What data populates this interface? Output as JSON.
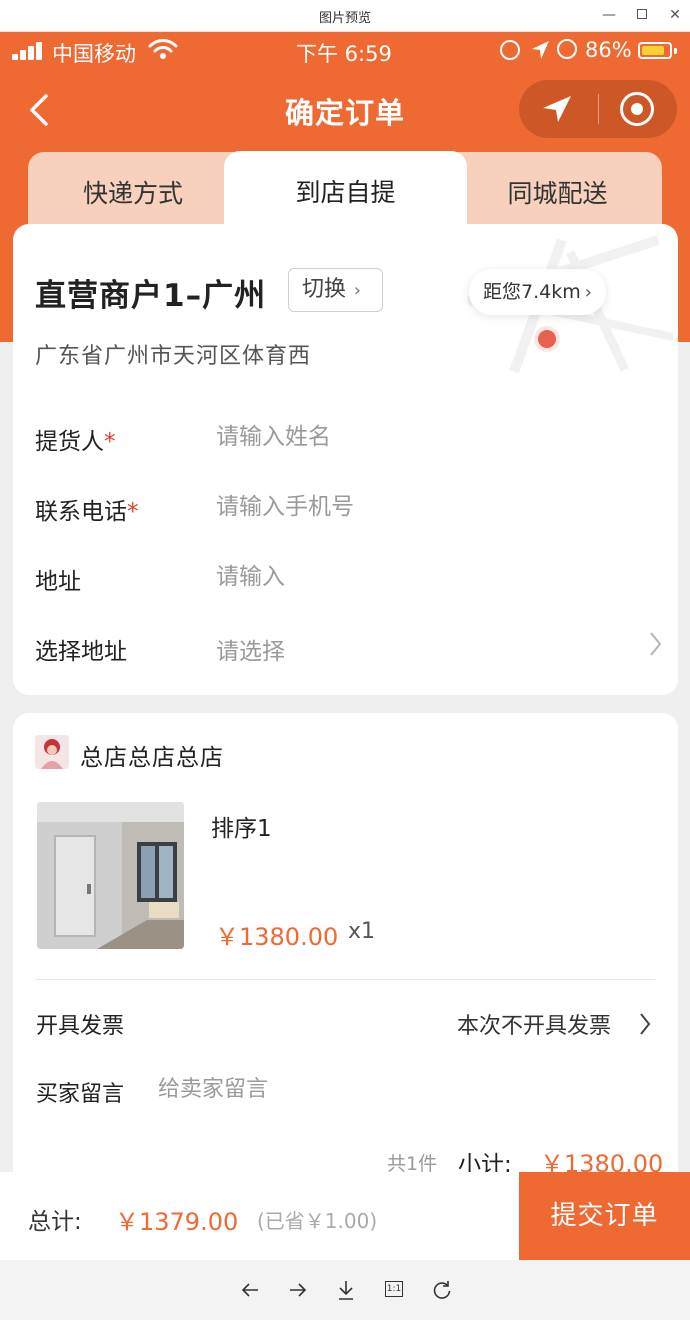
{
  "window": {
    "title": "图片预览",
    "minimize_label": "—",
    "close_label": "✕"
  },
  "status_bar": {
    "carrier": "中国移动",
    "time": "下午 6:59",
    "battery_percent": "86%",
    "battery_level": 0.86
  },
  "nav": {
    "title": "确定订单"
  },
  "tabs": [
    {
      "label": "快递方式",
      "active": false
    },
    {
      "label": "到店自提",
      "active": true
    },
    {
      "label": "同城配送",
      "active": false
    }
  ],
  "store": {
    "name": "直营商户1–广州",
    "switch_label": "切换",
    "address": "广东省广州市天河区体育西",
    "distance": "距您7.4km"
  },
  "form": {
    "pickup_person": {
      "label": "提货人",
      "required_mark": "*",
      "placeholder": "请输入姓名",
      "value": ""
    },
    "phone": {
      "label": "联系电话",
      "required_mark": "*",
      "placeholder": "请输入手机号",
      "value": ""
    },
    "address": {
      "label": "地址",
      "placeholder": "请输入",
      "value": ""
    },
    "select_address": {
      "label": "选择地址",
      "placeholder": "请选择"
    }
  },
  "order": {
    "shop_name": "总店总店总店",
    "product": {
      "name": "排序1",
      "price": "￥1380.00",
      "quantity": "x1"
    },
    "invoice": {
      "label": "开具发票",
      "value": "本次不开具发票"
    },
    "message": {
      "label": "买家留言",
      "placeholder": "给卖家留言",
      "value": ""
    },
    "item_count": "共1件",
    "subtotal_label": "小计:",
    "subtotal": "￥1380.00"
  },
  "footer": {
    "total_label": "总计:",
    "total": "￥1379.00",
    "saved": "(已省￥1.00)",
    "submit_label": "提交订单"
  },
  "viewer_toolbar": {
    "buttons": [
      "previous-icon",
      "next-icon",
      "download-icon",
      "actual-size-icon",
      "rotate-icon"
    ],
    "actual_size_text": "1:1"
  },
  "colors": {
    "accent": "#ef6a33",
    "tab_inactive": "#f7d1bd",
    "required": "#e33c2f",
    "map_pin": "#e8604e"
  }
}
